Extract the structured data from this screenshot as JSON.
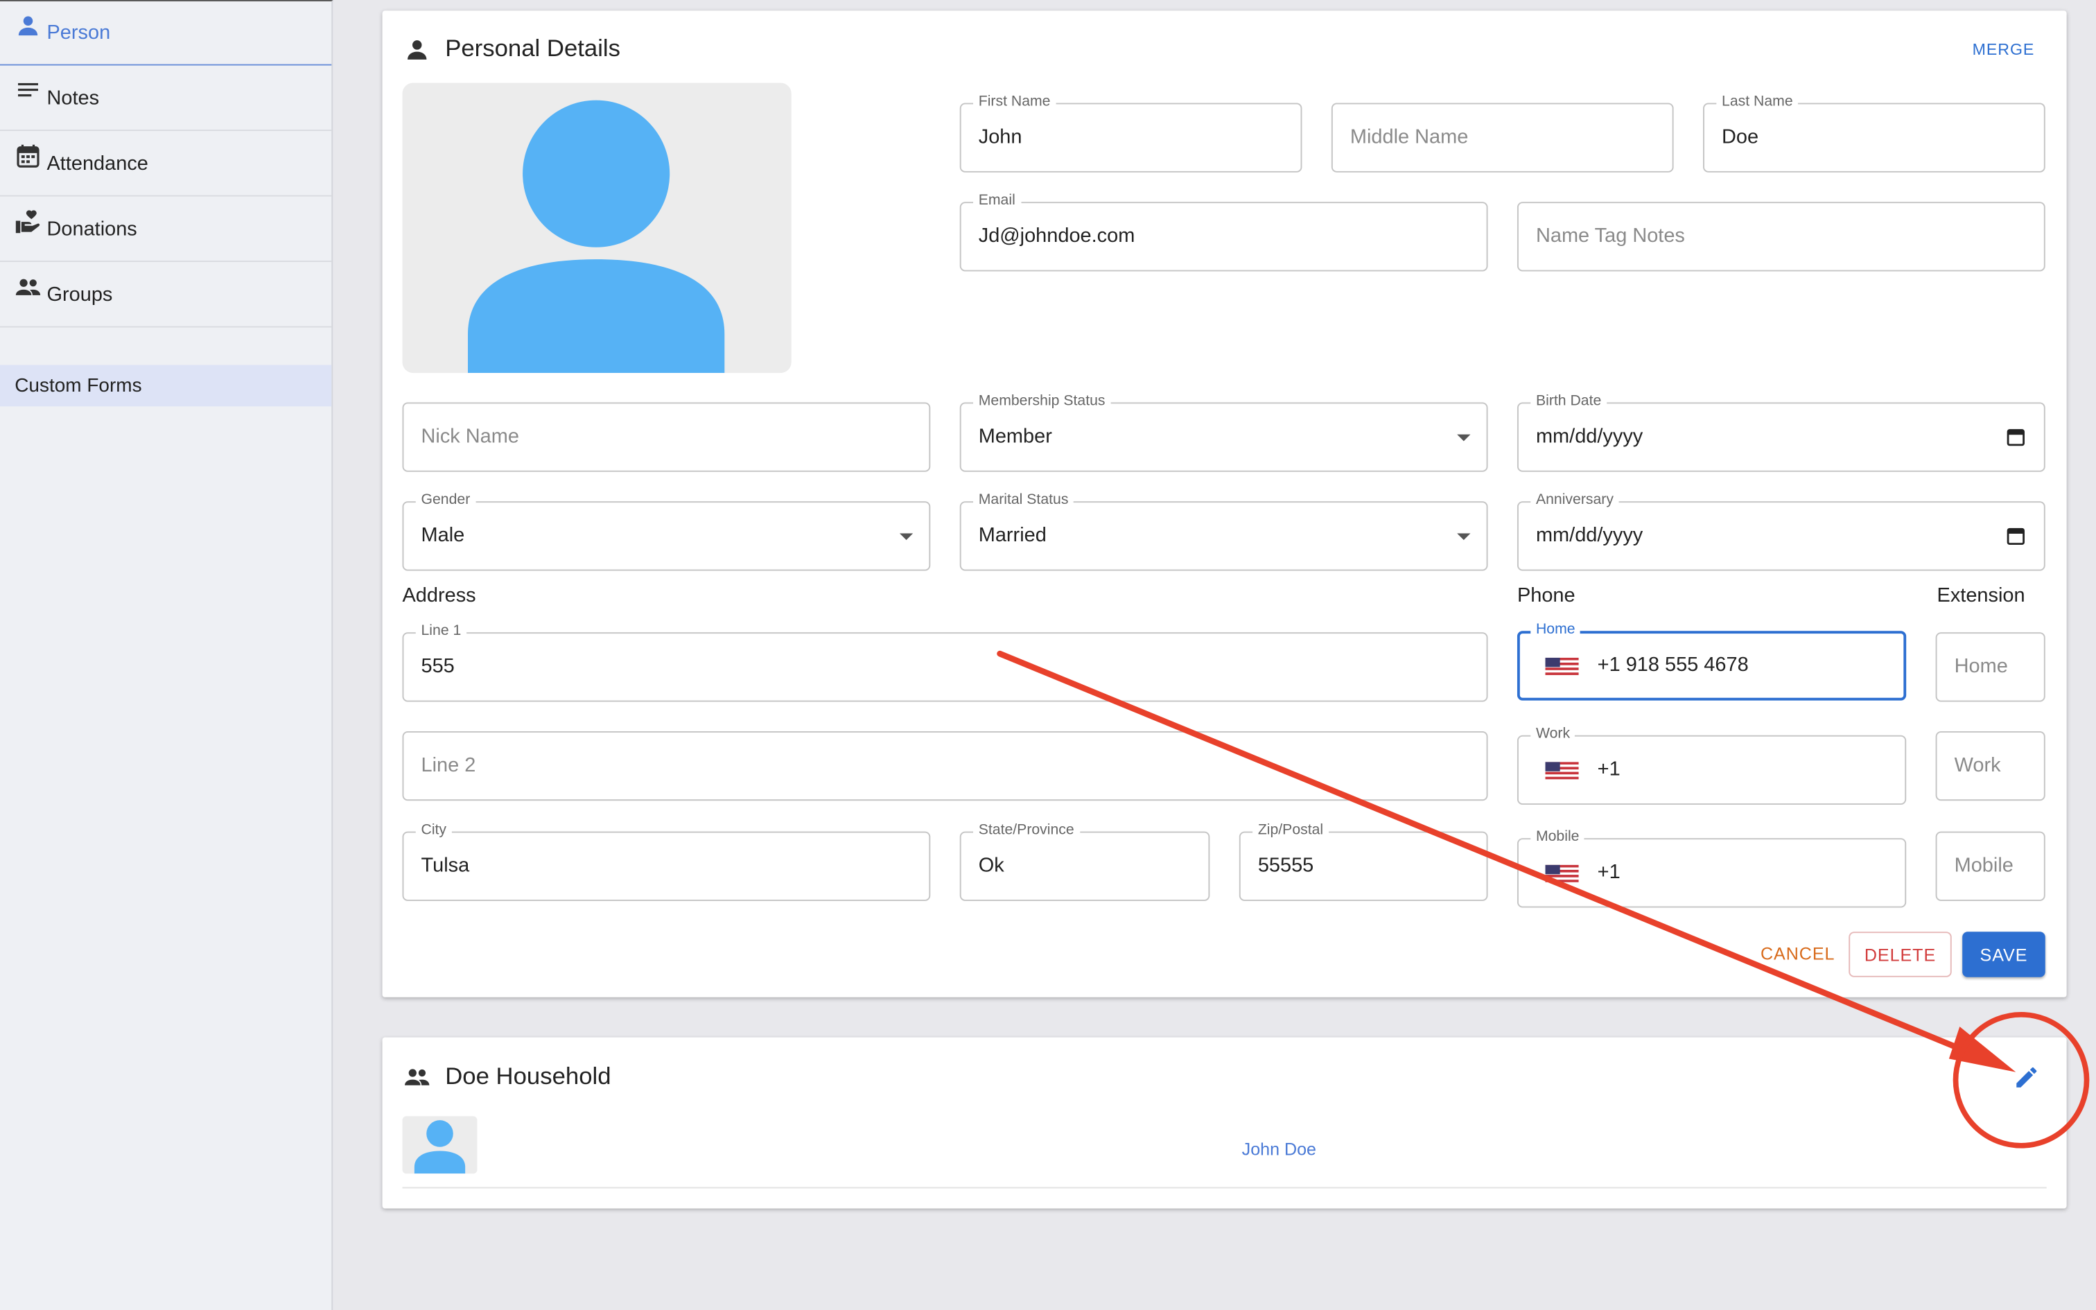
{
  "sidebar": {
    "items": [
      {
        "label": "Person",
        "icon": "person-icon",
        "active": true
      },
      {
        "label": "Notes",
        "icon": "notes-icon",
        "active": false
      },
      {
        "label": "Attendance",
        "icon": "calendar-icon",
        "active": false
      },
      {
        "label": "Donations",
        "icon": "donation-icon",
        "active": false
      },
      {
        "label": "Groups",
        "icon": "group-icon",
        "active": false
      }
    ],
    "custom_forms_label": "Custom Forms"
  },
  "personal": {
    "title": "Personal Details",
    "merge_label": "MERGE",
    "first_name": {
      "label": "First Name",
      "value": "John"
    },
    "middle_name": {
      "placeholder": "Middle Name"
    },
    "last_name": {
      "label": "Last Name",
      "value": "Doe"
    },
    "email": {
      "label": "Email",
      "value": "Jd@johndoe.com"
    },
    "name_tag_notes": {
      "placeholder": "Name Tag Notes"
    },
    "nick_name": {
      "placeholder": "Nick Name"
    },
    "membership_status": {
      "label": "Membership Status",
      "value": "Member"
    },
    "birth_date": {
      "label": "Birth Date",
      "value": "mm/dd/yyyy"
    },
    "gender": {
      "label": "Gender",
      "value": "Male"
    },
    "marital_status": {
      "label": "Marital Status",
      "value": "Married"
    },
    "anniversary": {
      "label": "Anniversary",
      "value": "mm/dd/yyyy"
    },
    "address_label": "Address",
    "phone_label": "Phone",
    "extension_label": "Extension",
    "line1": {
      "label": "Line 1",
      "value": "555"
    },
    "line2": {
      "placeholder": "Line 2"
    },
    "city": {
      "label": "City",
      "value": "Tulsa"
    },
    "state": {
      "label": "State/Province",
      "value": "Ok"
    },
    "zip": {
      "label": "Zip/Postal",
      "value": "55555"
    },
    "phone_home": {
      "label": "Home",
      "value": "+1 918 555 4678"
    },
    "phone_work": {
      "label": "Work",
      "value": "+1"
    },
    "phone_mobile": {
      "label": "Mobile",
      "value": "+1"
    },
    "ext_home": {
      "placeholder": "Home"
    },
    "ext_work": {
      "placeholder": "Work"
    },
    "ext_mobile": {
      "placeholder": "Mobile"
    },
    "cancel_label": "CANCEL",
    "delete_label": "DELETE",
    "save_label": "SAVE"
  },
  "household": {
    "title": "Doe Household",
    "members": [
      {
        "name": "John Doe"
      }
    ]
  },
  "colors": {
    "accent": "#2d6fd1",
    "avatar": "#56b2f5",
    "annotation": "#e8412b",
    "cancel": "#d86a1a",
    "delete": "#d23c3c"
  }
}
